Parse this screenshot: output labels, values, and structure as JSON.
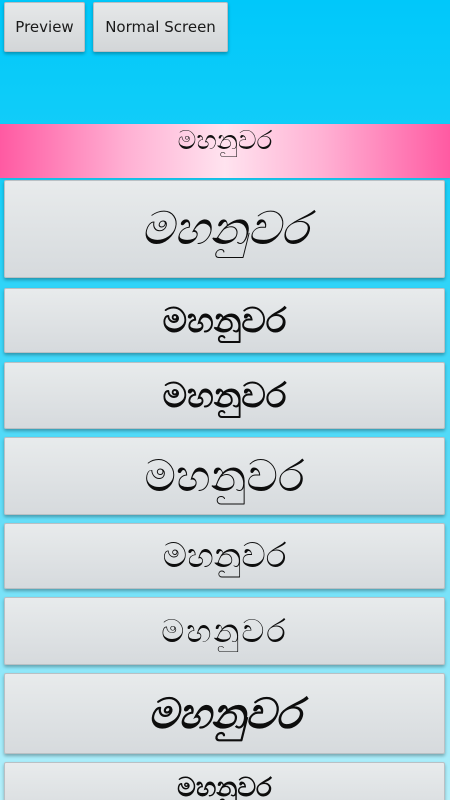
{
  "toolbar": {
    "preview_label": "Preview",
    "normal_screen_label": "Normal Screen"
  },
  "preview_text": "මහනුවර",
  "font_items": [
    {
      "text": "මහනුවර"
    },
    {
      "text": "මහනුවර"
    },
    {
      "text": "මහනුවර"
    },
    {
      "text": "මහනුවර"
    },
    {
      "text": "මහනුවර"
    },
    {
      "text": "මහනුවර"
    },
    {
      "text": "මහනුවර"
    },
    {
      "text": "මහනුවර"
    }
  ],
  "colors": {
    "background_top": "#00c8fa",
    "background_bottom": "#b6f0fb",
    "banner_edge": "#ff5aa2",
    "banner_center": "#ffe3ef",
    "button_face": "#dcdfe1"
  }
}
